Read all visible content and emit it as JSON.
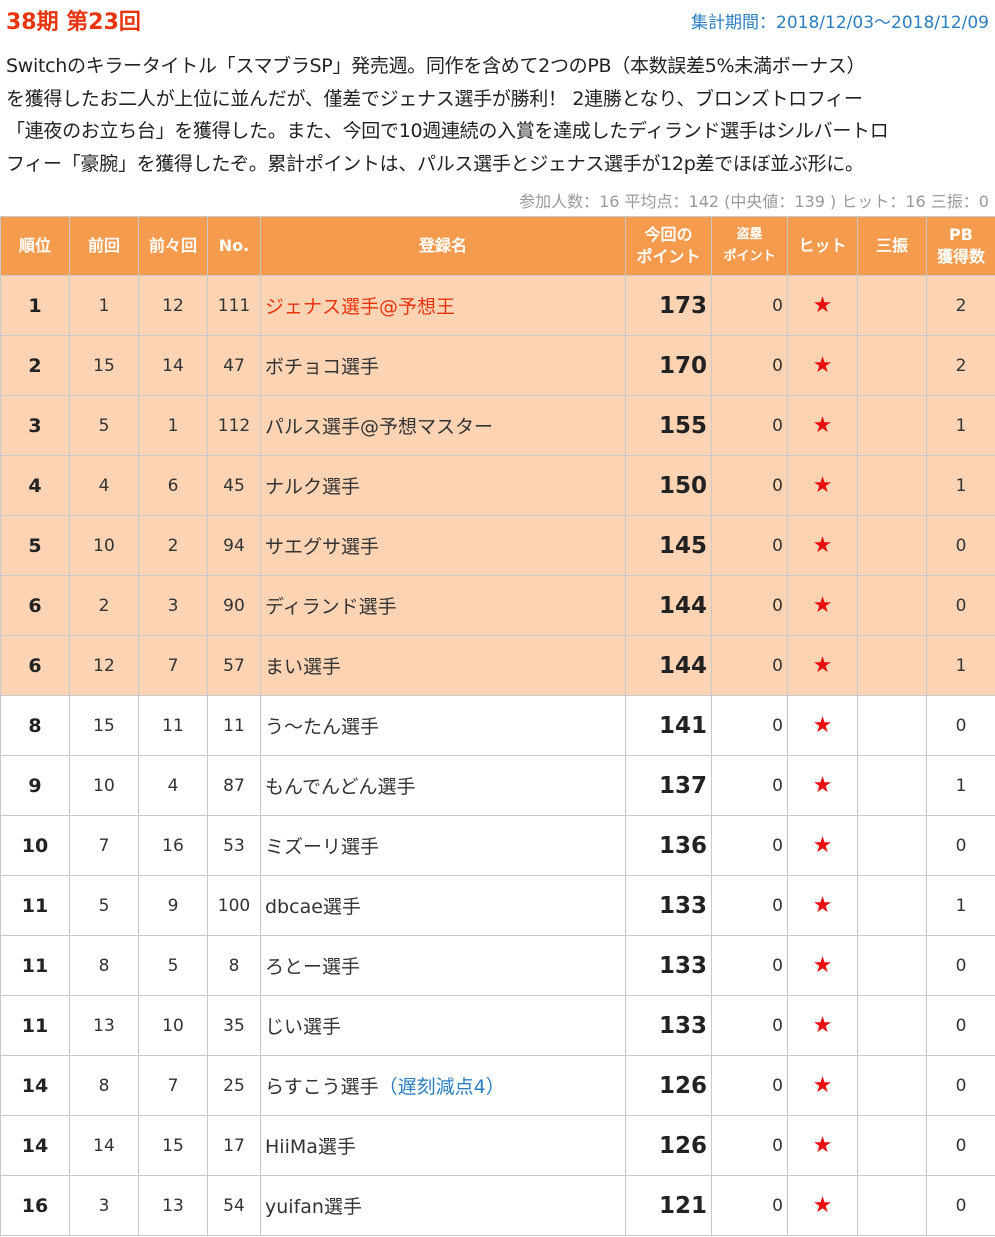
{
  "header": {
    "title": "38期 第23回",
    "period": "集計期間：2018/12/03～2018/12/09"
  },
  "description": [
    "Switchのキラータイトル「スマブラSP」発売週。同作を含めて2つのPB（本数誤差5%未満ボーナス）",
    "を獲得したお二人が上位に並んだが、僅差でジェナス選手が勝利！ 2連勝となり、ブロンズトロフィー",
    "「連夜のお立ち台」を獲得した。また、今回で10週連続の入賞を達成したディランド選手はシルバートロ",
    "フィー「豪腕」を獲得したぞ。累計ポイントは、パルス選手とジェナス選手が12p差でほぼ並ぶ形に。"
  ],
  "stats": "参加人数：16 平均点：142 (中央値：139 ) ヒット：16 三振：0",
  "columns": {
    "rank": "順位",
    "prev": "前回",
    "prev2": "前々回",
    "no": "No.",
    "name": "登録名",
    "points_l1": "今回の",
    "points_l2": "ポイント",
    "theft_l1": "盗塁",
    "theft_l2": "ポイント",
    "hit": "ヒット",
    "strikeout": "三振",
    "pb_l1": "PB",
    "pb_l2": "獲得数"
  },
  "rows": [
    {
      "rank": "1",
      "prev": "1",
      "prev2": "12",
      "no": "111",
      "name": "ジェナス選手@予想王",
      "points": "173",
      "theft": "0",
      "hit": "★",
      "strikeout": "",
      "pb": "2"
    },
    {
      "rank": "2",
      "prev": "15",
      "prev2": "14",
      "no": "47",
      "name": "ボチョコ選手",
      "points": "170",
      "theft": "0",
      "hit": "★",
      "strikeout": "",
      "pb": "2"
    },
    {
      "rank": "3",
      "prev": "5",
      "prev2": "1",
      "no": "112",
      "name": "パルス選手@予想マスター",
      "points": "155",
      "theft": "0",
      "hit": "★",
      "strikeout": "",
      "pb": "1"
    },
    {
      "rank": "4",
      "prev": "4",
      "prev2": "6",
      "no": "45",
      "name": "ナルク選手",
      "points": "150",
      "theft": "0",
      "hit": "★",
      "strikeout": "",
      "pb": "1"
    },
    {
      "rank": "5",
      "prev": "10",
      "prev2": "2",
      "no": "94",
      "name": "サエグサ選手",
      "points": "145",
      "theft": "0",
      "hit": "★",
      "strikeout": "",
      "pb": "0"
    },
    {
      "rank": "6",
      "prev": "2",
      "prev2": "3",
      "no": "90",
      "name": "ディランド選手",
      "points": "144",
      "theft": "0",
      "hit": "★",
      "strikeout": "",
      "pb": "0"
    },
    {
      "rank": "6",
      "prev": "12",
      "prev2": "7",
      "no": "57",
      "name": "まい選手",
      "points": "144",
      "theft": "0",
      "hit": "★",
      "strikeout": "",
      "pb": "1"
    },
    {
      "rank": "8",
      "prev": "15",
      "prev2": "11",
      "no": "11",
      "name": "う～たん選手",
      "points": "141",
      "theft": "0",
      "hit": "★",
      "strikeout": "",
      "pb": "0"
    },
    {
      "rank": "9",
      "prev": "10",
      "prev2": "4",
      "no": "87",
      "name": "もんでんどん選手",
      "points": "137",
      "theft": "0",
      "hit": "★",
      "strikeout": "",
      "pb": "1"
    },
    {
      "rank": "10",
      "prev": "7",
      "prev2": "16",
      "no": "53",
      "name": "ミズーリ選手",
      "points": "136",
      "theft": "0",
      "hit": "★",
      "strikeout": "",
      "pb": "0"
    },
    {
      "rank": "11",
      "prev": "5",
      "prev2": "9",
      "no": "100",
      "name": "dbcae選手",
      "points": "133",
      "theft": "0",
      "hit": "★",
      "strikeout": "",
      "pb": "1"
    },
    {
      "rank": "11",
      "prev": "8",
      "prev2": "5",
      "no": "8",
      "name": "ろとー選手",
      "points": "133",
      "theft": "0",
      "hit": "★",
      "strikeout": "",
      "pb": "0"
    },
    {
      "rank": "11",
      "prev": "13",
      "prev2": "10",
      "no": "35",
      "name": "じい選手",
      "points": "133",
      "theft": "0",
      "hit": "★",
      "strikeout": "",
      "pb": "0"
    },
    {
      "rank": "14",
      "prev": "8",
      "prev2": "7",
      "no": "25",
      "name": "らすこう選手",
      "note": "（遅刻減点4）",
      "points": "126",
      "theft": "0",
      "hit": "★",
      "strikeout": "",
      "pb": "0"
    },
    {
      "rank": "14",
      "prev": "14",
      "prev2": "15",
      "no": "17",
      "name": "HiiMa選手",
      "points": "126",
      "theft": "0",
      "hit": "★",
      "strikeout": "",
      "pb": "0"
    },
    {
      "rank": "16",
      "prev": "3",
      "prev2": "13",
      "no": "54",
      "name": "yuifan選手",
      "points": "121",
      "theft": "0",
      "hit": "★",
      "strikeout": "",
      "pb": "0"
    }
  ],
  "colors": {
    "title": "#e8350f",
    "period": "#2a7fc1",
    "header_bg": "#f59b4e",
    "highlight_row": "#fcd4b4",
    "star": "#e8100f",
    "note": "#2a7fc1"
  }
}
